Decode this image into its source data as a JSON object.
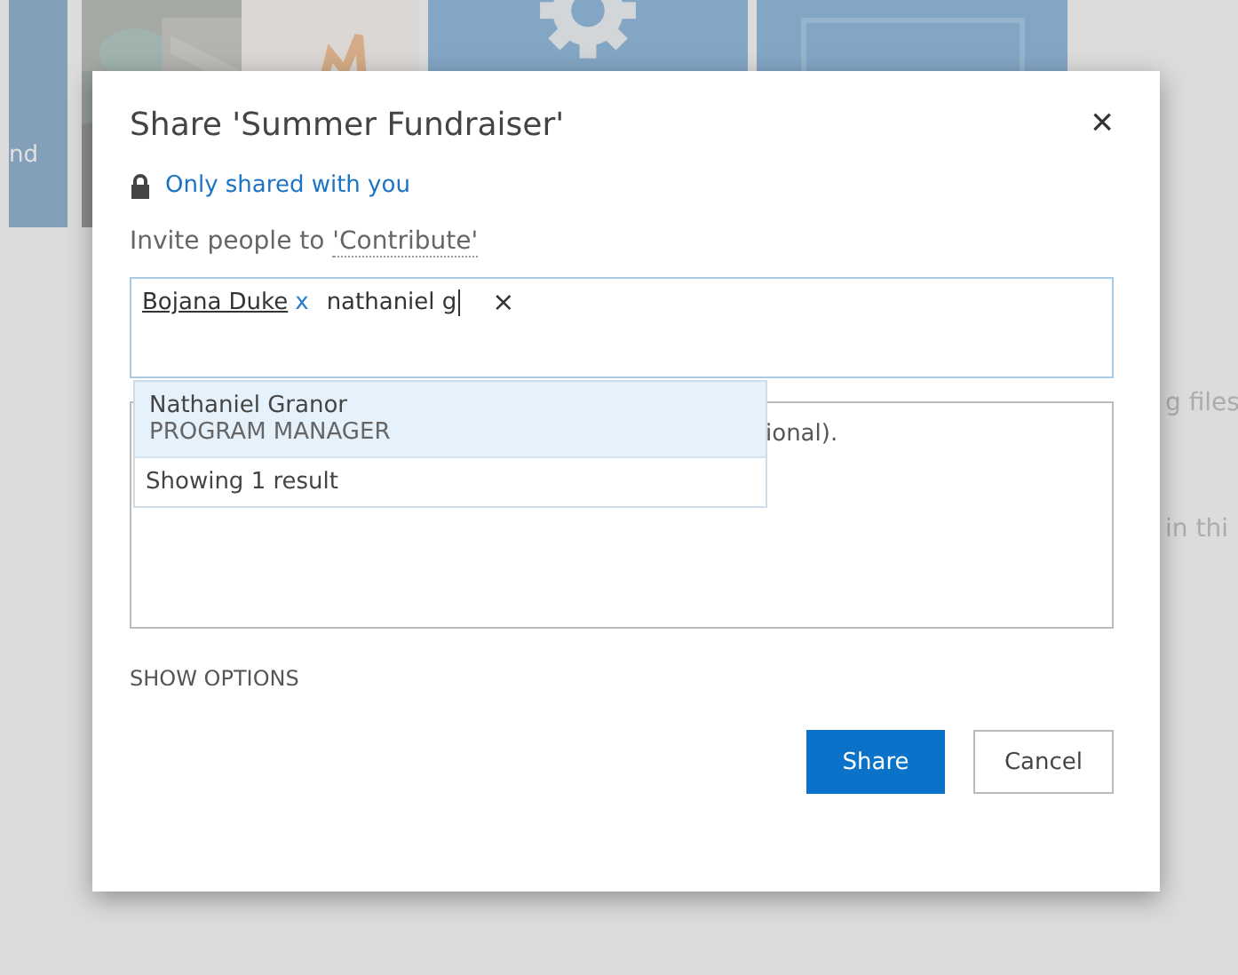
{
  "background": {
    "tile_label": "nd",
    "side_texts": [
      "g files",
      "in thi"
    ]
  },
  "dialog": {
    "title": "Share 'Summer Fundraiser'",
    "close": "×",
    "sharing_status": "Only shared with you",
    "invite_prefix": "Invite people to ",
    "permission": "'Contribute'",
    "people_field": {
      "tokens": [
        {
          "name": "Bojana Duke",
          "remove": "x"
        }
      ],
      "value": "nathaniel g",
      "clear": "×"
    },
    "suggestions": [
      {
        "name": "Nathaniel Granor",
        "title": "PROGRAM MANAGER",
        "selected": true
      }
    ],
    "result_count": "Showing 1 result",
    "message_visible": "ional).",
    "show_options": "SHOW OPTIONS",
    "buttons": [
      {
        "label": "Share",
        "kind": "primary"
      },
      {
        "label": "Cancel",
        "kind": "secondary"
      }
    ]
  }
}
